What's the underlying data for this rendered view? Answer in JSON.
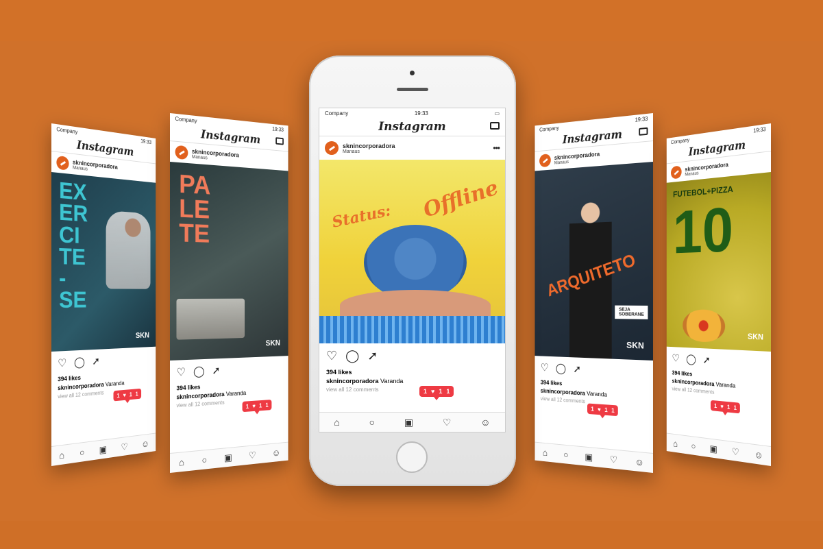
{
  "app": {
    "name": "Instagram"
  },
  "status": {
    "carrier": "Company",
    "time": "19:33"
  },
  "post": {
    "username": "sknincorporadora",
    "location": "Manaus",
    "likes": "394 likes",
    "caption_text": "Varanda",
    "comments": "view all 12 comments"
  },
  "notification": {
    "comments": "1",
    "likes": "1",
    "followers": "1"
  },
  "posters": {
    "p1_lines": [
      "EX",
      "ER",
      "CI",
      "TE",
      "-",
      "SE"
    ],
    "p2_lines": [
      "PA",
      "LE",
      "TE"
    ],
    "p3_status": "Status:",
    "p3_offline": "Offline",
    "p4_word": "ARQUITETO",
    "p4_sub": "SEJA\nSOBERANE",
    "p5_title": "FUTEBOL+PIZZA",
    "p5_number": "10",
    "brand": "SKN"
  },
  "colors": {
    "background": "#d0712a",
    "accent": "#ee3a43",
    "brand": "#e1601d"
  },
  "icons": [
    "heart-icon",
    "comment-icon",
    "share-icon",
    "home-icon",
    "search-icon",
    "camera-icon",
    "activity-icon",
    "profile-icon",
    "inbox-icon"
  ]
}
